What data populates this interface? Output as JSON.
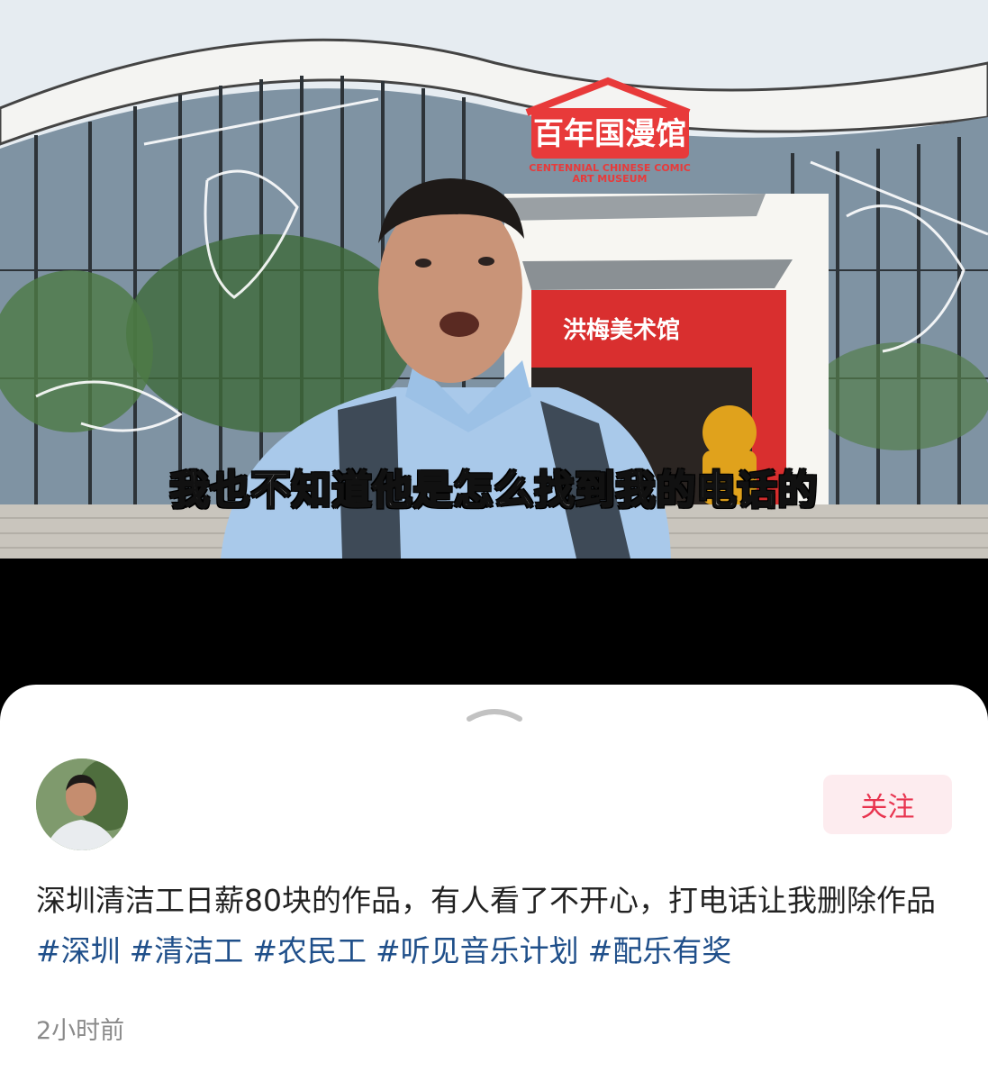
{
  "video": {
    "subtitle": "我也不知道他是怎么找到我的电话的",
    "signs": {
      "main_cn": "百年国漫馆",
      "main_en_line1": "CENTENNIAL CHINESE COMIC",
      "main_en_line2": "ART MUSEUM",
      "gallery": "洪梅美术馆"
    }
  },
  "sheet": {
    "follow_label": "关注",
    "caption_text": "深圳清洁工日薪80块的作品，有人看了不开心，打电话让我删除作品",
    "hashtags": [
      "#深圳",
      "#清洁工",
      "#农民工",
      "#听见音乐计划",
      "#配乐有奖"
    ],
    "timestamp": "2小时前"
  },
  "colors": {
    "follow_text": "#e8344f",
    "follow_bg": "#fdecef",
    "hashtag": "#1f4f8a"
  }
}
